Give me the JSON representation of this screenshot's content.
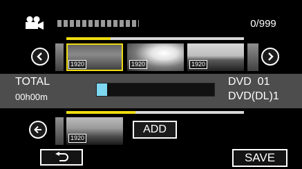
{
  "header": {
    "mode_icon": "video-camera-icon",
    "date_placeholder_icon": "date-dots-placeholder",
    "counter": "0/999"
  },
  "scene_row": {
    "prev_icon": "chevron-left-circle-icon",
    "next_icon": "chevron-right-circle-icon",
    "thumb_badges": [
      "1920",
      "1920",
      "1920"
    ],
    "progress_fraction": 0.25
  },
  "status": {
    "total_label": "TOTAL",
    "total_time": "00h00m",
    "capacity_fraction": 0.09,
    "disc_line1": "DVD  01",
    "disc_line2": "DVD(DL)1",
    "capacity_color": "#7dd8f0"
  },
  "selection_row": {
    "back_icon": "arrow-left-circle-icon",
    "thumb_badges": [
      "1920"
    ],
    "add_label": "ADD",
    "progress_fraction": 0.39
  },
  "footer": {
    "return_icon": "return-arrow-icon",
    "save_label": "SAVE"
  },
  "colors": {
    "accent": "#f0dd10",
    "band": "#4d4d4d",
    "background": "#000000"
  }
}
